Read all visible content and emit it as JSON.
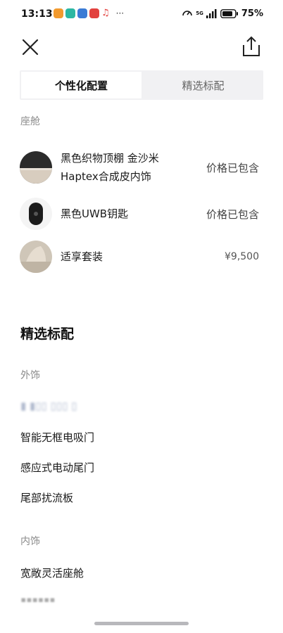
{
  "status_bar": {
    "time": "13:13",
    "more": "···",
    "network": "5G",
    "battery_percent": "75%"
  },
  "tabs": [
    {
      "label": "个性化配置",
      "active": true
    },
    {
      "label": "精选标配",
      "active": false
    }
  ],
  "personalized": {
    "section_label": "座舱",
    "items": [
      {
        "name": "黑色织物顶棚 金沙米Haptex合成皮内饰",
        "price": "价格已包含"
      },
      {
        "name": "黑色UWB钥匙",
        "price": "价格已包含"
      },
      {
        "name": "适享套装",
        "price": "¥9,500"
      }
    ]
  },
  "standard": {
    "title": "精选标配",
    "exterior_label": "外饰",
    "exterior_items": [
      "智能无框电吸门",
      "感应式电动尾门",
      "尾部扰流板"
    ],
    "interior_label": "内饰",
    "interior_items": [
      "宽敞灵活座舱"
    ]
  },
  "colors": {
    "accent": "#111111",
    "muted": "#8a8a8a",
    "tab_bg": "#f1f1f3"
  }
}
